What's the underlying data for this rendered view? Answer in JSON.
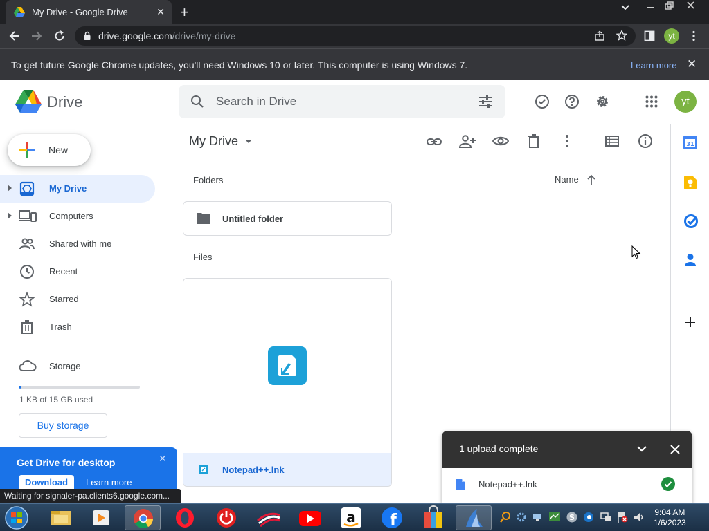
{
  "browser": {
    "tab_title": "My Drive - Google Drive",
    "url_host": "drive.google.com",
    "url_path": "/drive/my-drive",
    "profile_initials": "yt"
  },
  "infobar": {
    "message": "To get future Google Chrome updates, you'll need Windows 10 or later. This computer is using Windows 7.",
    "learn_more": "Learn more"
  },
  "drive": {
    "brand": "Drive",
    "search_placeholder": "Search in Drive",
    "avatar_initials": "yt"
  },
  "sidebar": {
    "new_label": "New",
    "items": [
      {
        "label": "My Drive",
        "icon": "my-drive-icon",
        "active": true
      },
      {
        "label": "Computers",
        "icon": "computers-icon"
      },
      {
        "label": "Shared with me",
        "icon": "shared-with-me-icon"
      },
      {
        "label": "Recent",
        "icon": "clock-icon"
      },
      {
        "label": "Starred",
        "icon": "star-icon"
      },
      {
        "label": "Trash",
        "icon": "trash-icon"
      },
      {
        "label": "Storage",
        "icon": "cloud-icon"
      }
    ],
    "storage_used_fraction": 0.0001,
    "storage_text": "1 KB of 15 GB used",
    "buy_storage": "Buy storage"
  },
  "promo": {
    "title": "Get Drive for desktop",
    "download": "Download",
    "learn_more": "Learn more"
  },
  "status_text": "Waiting for signaler-pa.clients6.google.com...",
  "main": {
    "title": "My Drive",
    "folders_header": "Folders",
    "files_header": "Files",
    "sort_label": "Name",
    "folders": [
      {
        "name": "Untitled folder"
      }
    ],
    "files": [
      {
        "name": "Notepad++.lnk"
      }
    ]
  },
  "upload": {
    "title": "1 upload complete",
    "items": [
      {
        "name": "Notepad++.lnk",
        "status": "complete"
      }
    ]
  },
  "taskbar": {
    "time": "9:04 AM",
    "date": "1/6/2023"
  },
  "colors": {
    "accent": "#1a73e8",
    "active_nav_bg": "#e8f0fe",
    "success": "#1e8e3e",
    "avatar": "#7cb342"
  }
}
